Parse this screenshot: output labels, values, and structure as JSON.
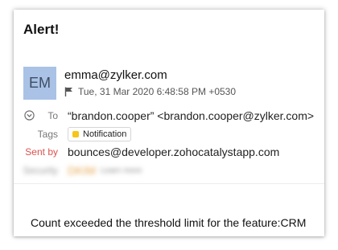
{
  "email": {
    "subject": "Alert!",
    "avatar_initials": "EM",
    "avatar_color": "#a9c2e6",
    "from": "emma@zylker.com",
    "date": "Tue, 31 Mar 2020 6:48:58 PM +0530",
    "to_label": "To",
    "to_value": "“brandon.cooper” <brandon.cooper@zylker.com>",
    "tags_label": "Tags",
    "tag": {
      "name": "Notification",
      "color": "#f5c518"
    },
    "sent_by_label": "Sent by",
    "sent_by_label_color": "#d9534f",
    "sent_by_value": "bounces@developer.zohocatalystapp.com",
    "security_label": "Security",
    "security_value": "DKIM",
    "security_detail": "Learn more",
    "body": "Count exceeded the threshold limit for the feature:CRM"
  },
  "icons": {
    "flag": "flag-icon",
    "collapse": "chevron-circle-icon"
  }
}
